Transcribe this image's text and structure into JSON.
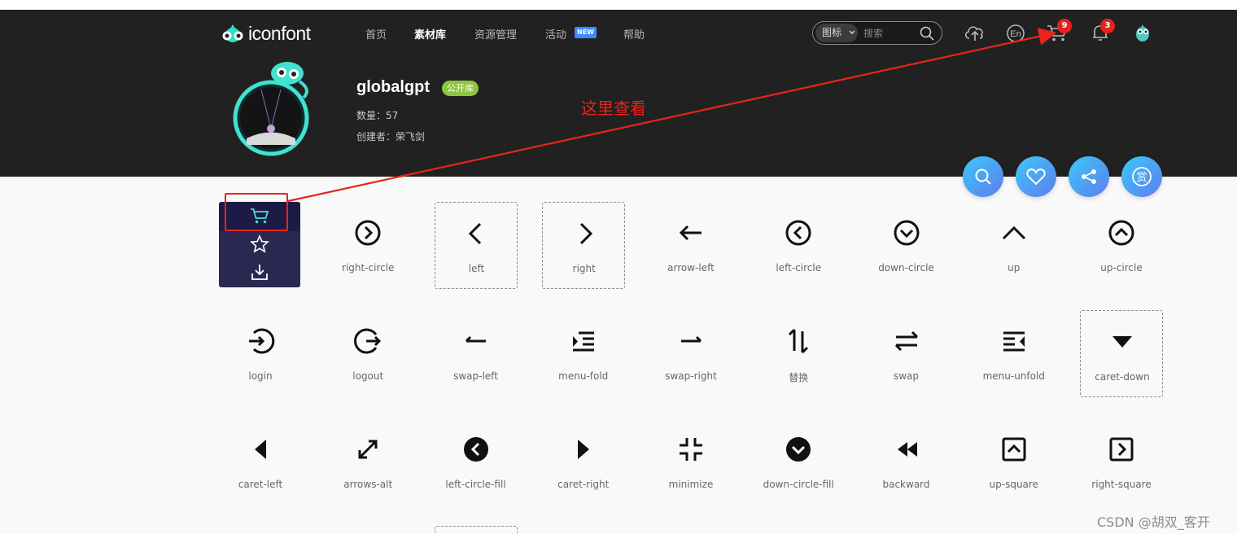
{
  "header": {
    "logo_text": "iconfont",
    "nav": [
      {
        "label": "首页",
        "active": false
      },
      {
        "label": "素材库",
        "active": true
      },
      {
        "label": "资源管理",
        "active": false
      },
      {
        "label": "活动",
        "active": false,
        "badge": "NEW"
      },
      {
        "label": "帮助",
        "active": false
      }
    ],
    "search": {
      "type_label": "图标",
      "placeholder": "搜索"
    },
    "cart_count": "9",
    "notification_count": "3",
    "icons": [
      "upload-cloud-icon",
      "language-en-icon",
      "cart-icon",
      "bell-icon",
      "user-avatar"
    ]
  },
  "library": {
    "title": "globalgpt",
    "badge": "公开库",
    "count_line": "数量：57",
    "creator_line": "创建者：荣飞剑"
  },
  "annotation": {
    "text": "这里查看",
    "color": "#e8241c"
  },
  "fab_buttons": [
    "search-icon",
    "heart-icon",
    "share-icon",
    "reward-icon"
  ],
  "hover_card_actions": [
    "cart-icon",
    "star-icon",
    "download-icon"
  ],
  "icons_grid": [
    {
      "label": "",
      "icon": "cart-hover"
    },
    {
      "label": "right-circle",
      "icon": "right-circle"
    },
    {
      "label": "left",
      "icon": "left"
    },
    {
      "label": "right",
      "icon": "right"
    },
    {
      "label": "arrow-left",
      "icon": "arrow-left"
    },
    {
      "label": "left-circle",
      "icon": "left-circle"
    },
    {
      "label": "down-circle",
      "icon": "down-circle"
    },
    {
      "label": "up",
      "icon": "up"
    },
    {
      "label": "up-circle",
      "icon": "up-circle"
    },
    {
      "label": "login",
      "icon": "login"
    },
    {
      "label": "logout",
      "icon": "logout"
    },
    {
      "label": "swap-left",
      "icon": "swap-left"
    },
    {
      "label": "menu-fold",
      "icon": "menu-fold"
    },
    {
      "label": "swap-right",
      "icon": "swap-right"
    },
    {
      "label": "替换",
      "icon": "replace"
    },
    {
      "label": "swap",
      "icon": "swap"
    },
    {
      "label": "menu-unfold",
      "icon": "menu-unfold"
    },
    {
      "label": "caret-down",
      "icon": "caret-down"
    },
    {
      "label": "caret-left",
      "icon": "caret-left"
    },
    {
      "label": "arrows-alt",
      "icon": "arrows-alt"
    },
    {
      "label": "left-circle-fill",
      "icon": "left-circle-fill"
    },
    {
      "label": "caret-right",
      "icon": "caret-right"
    },
    {
      "label": "minimize",
      "icon": "minimize"
    },
    {
      "label": "down-circle-fill",
      "icon": "down-circle-fill"
    },
    {
      "label": "backward",
      "icon": "backward"
    },
    {
      "label": "up-square",
      "icon": "up-square"
    },
    {
      "label": "right-square",
      "icon": "right-square"
    }
  ],
  "watermark": "CSDN @胡双_客开"
}
